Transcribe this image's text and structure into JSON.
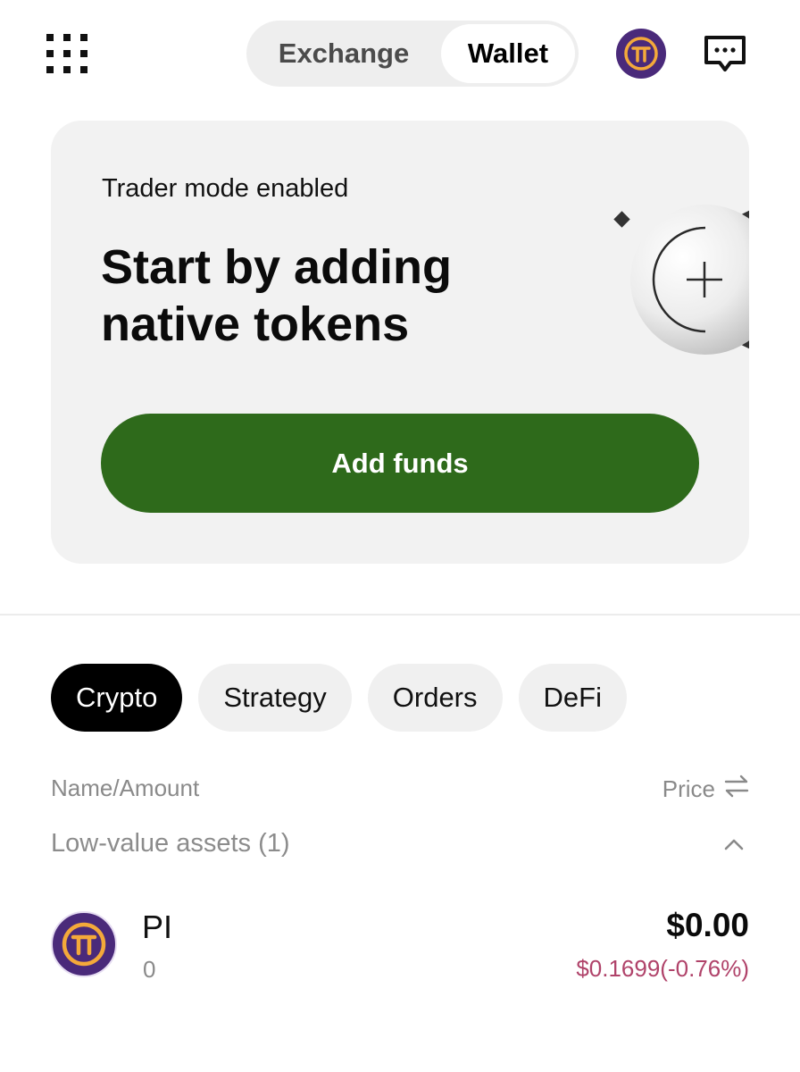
{
  "header": {
    "apps_icon": "grid-apps-icon",
    "segments": [
      {
        "label": "Exchange",
        "selected": false
      },
      {
        "label": "Wallet",
        "selected": true
      }
    ],
    "avatar_icon": "pi-network-logo",
    "chat_icon": "message-icon"
  },
  "promo": {
    "subtitle": "Trader mode enabled",
    "title_line1": "Start by adding",
    "title_line2": "native tokens",
    "button_label": "Add funds",
    "art_icon": "plus-circle-icon"
  },
  "tabs": [
    {
      "label": "Crypto",
      "active": true
    },
    {
      "label": "Strategy",
      "active": false
    },
    {
      "label": "Orders",
      "active": false
    },
    {
      "label": "DeFi",
      "active": false
    }
  ],
  "list": {
    "col_name": "Name/Amount",
    "col_price": "Price",
    "sort_icon": "swap-arrows-icon",
    "group_label": "Low-value assets (1)",
    "group_expanded": true,
    "assets": [
      {
        "symbol": "PI",
        "amount": "0",
        "value": "$0.00",
        "price_change": "$0.1699(-0.76%)",
        "logo_icon": "pi-network-logo"
      }
    ]
  },
  "colors": {
    "accent_green": "#2e6a1b",
    "negative_pink": "#b0436a",
    "pi_purple": "#4a2a7a",
    "pi_gold": "#f4a93a"
  }
}
